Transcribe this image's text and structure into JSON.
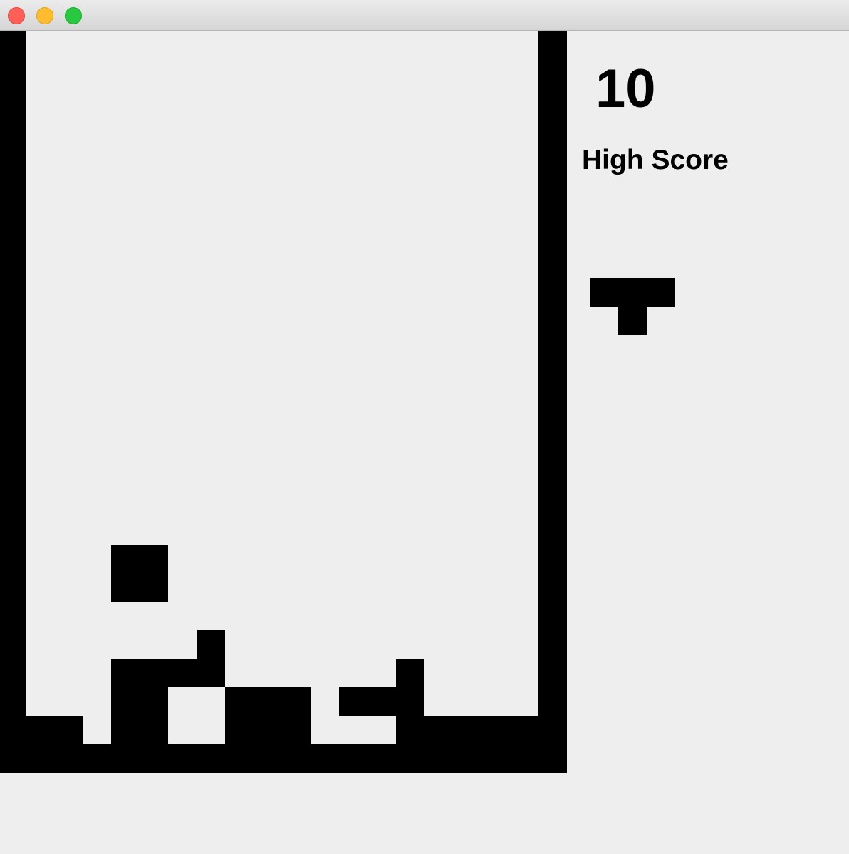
{
  "window": {
    "controls": [
      "close",
      "minimize",
      "zoom"
    ]
  },
  "game": {
    "score": "10",
    "high_score_label": "High Score",
    "board": {
      "columns": 18,
      "rows": 26,
      "filled_cells": [
        [
          0,
          0
        ],
        [
          0,
          1
        ],
        [
          0,
          2
        ],
        [
          0,
          3
        ],
        [
          0,
          4
        ],
        [
          0,
          5
        ],
        [
          0,
          6
        ],
        [
          0,
          7
        ],
        [
          0,
          8
        ],
        [
          0,
          9
        ],
        [
          0,
          10
        ],
        [
          0,
          11
        ],
        [
          0,
          12
        ],
        [
          0,
          13
        ],
        [
          0,
          14
        ],
        [
          0,
          15
        ],
        [
          0,
          16
        ],
        [
          0,
          17
        ],
        [
          0,
          18
        ],
        [
          0,
          19
        ],
        [
          0,
          20
        ],
        [
          0,
          21
        ],
        [
          0,
          22
        ],
        [
          0,
          23
        ],
        [
          0,
          24
        ],
        [
          0,
          25
        ],
        [
          19,
          0
        ],
        [
          19,
          1
        ],
        [
          19,
          2
        ],
        [
          19,
          3
        ],
        [
          19,
          4
        ],
        [
          19,
          5
        ],
        [
          19,
          6
        ],
        [
          19,
          7
        ],
        [
          19,
          8
        ],
        [
          19,
          9
        ],
        [
          19,
          10
        ],
        [
          19,
          11
        ],
        [
          19,
          12
        ],
        [
          19,
          13
        ],
        [
          19,
          14
        ],
        [
          19,
          15
        ],
        [
          19,
          16
        ],
        [
          19,
          17
        ],
        [
          19,
          18
        ],
        [
          19,
          19
        ],
        [
          19,
          20
        ],
        [
          19,
          21
        ],
        [
          19,
          22
        ],
        [
          19,
          23
        ],
        [
          19,
          24
        ],
        [
          19,
          25
        ],
        [
          1,
          25
        ],
        [
          2,
          25
        ],
        [
          3,
          25
        ],
        [
          4,
          25
        ],
        [
          5,
          25
        ],
        [
          6,
          25
        ],
        [
          7,
          25
        ],
        [
          8,
          25
        ],
        [
          9,
          25
        ],
        [
          10,
          25
        ],
        [
          11,
          25
        ],
        [
          12,
          25
        ],
        [
          13,
          25
        ],
        [
          14,
          25
        ],
        [
          15,
          25
        ],
        [
          16,
          25
        ],
        [
          17,
          25
        ],
        [
          18,
          25
        ],
        [
          1,
          24
        ],
        [
          2,
          24
        ],
        [
          4,
          24
        ],
        [
          5,
          24
        ],
        [
          8,
          24
        ],
        [
          9,
          24
        ],
        [
          10,
          24
        ],
        [
          14,
          24
        ],
        [
          15,
          24
        ],
        [
          16,
          24
        ],
        [
          17,
          24
        ],
        [
          18,
          24
        ],
        [
          4,
          23
        ],
        [
          5,
          23
        ],
        [
          8,
          23
        ],
        [
          9,
          23
        ],
        [
          10,
          23
        ],
        [
          12,
          23
        ],
        [
          13,
          23
        ],
        [
          14,
          23
        ],
        [
          4,
          22
        ],
        [
          5,
          22
        ],
        [
          6,
          22
        ],
        [
          7,
          22
        ],
        [
          14,
          22
        ],
        [
          7,
          21
        ],
        [
          4,
          18
        ],
        [
          5,
          18
        ],
        [
          4,
          19
        ],
        [
          5,
          19
        ]
      ]
    },
    "next_piece": {
      "shape": "T",
      "cells": [
        [
          0,
          0
        ],
        [
          1,
          0
        ],
        [
          2,
          0
        ],
        [
          1,
          1
        ]
      ]
    },
    "colors": {
      "background": "#eeeeee",
      "block": "#000000"
    }
  }
}
